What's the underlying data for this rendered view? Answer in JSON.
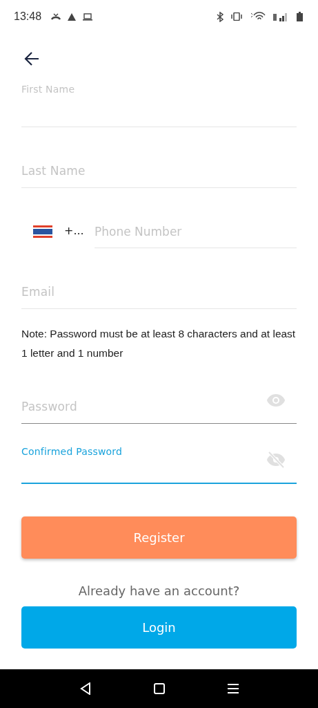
{
  "status_bar": {
    "time": "13:48"
  },
  "fields": [
    {
      "kind": "text",
      "label": "First Name",
      "floated": true,
      "focused": false
    },
    {
      "kind": "text",
      "label": "Last Name",
      "floated": false,
      "focused": false
    },
    {
      "kind": "phone",
      "code": "+...",
      "placeholder": "Phone Number"
    },
    {
      "kind": "text",
      "label": "Email",
      "floated": false,
      "focused": false
    },
    {
      "kind": "note",
      "text": "Note: Password must be at least 8 characters and at least 1 letter and 1 number"
    },
    {
      "kind": "password",
      "label": "Password",
      "floated": false,
      "focused": false,
      "visible": true
    },
    {
      "kind": "password",
      "label": "Confirmed Password",
      "floated": true,
      "focused": true,
      "visible": false
    }
  ],
  "register_button": "Register",
  "account_prompt": "Already have an account?",
  "login_button": "Login"
}
